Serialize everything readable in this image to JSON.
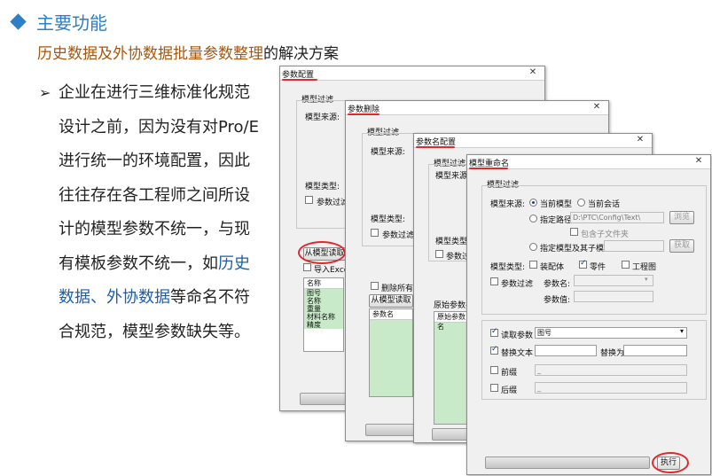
{
  "slide": {
    "title": "主要功能",
    "subtitle_highlight": "历史数据及外协数据批量参数整理",
    "subtitle_rest": "的解决方案",
    "bullet_part1": "企业在进行三维标准化规范设计之前，因为没有对Pro/E进行统一的环境配置，因此往往存在各工程师之间所设计的模型参数不统一，与现有模板参数不统一，如",
    "bullet_blue": "历史数据、外协数据",
    "bullet_part2": "等命名不符合规范，模型参数缺失等。"
  },
  "dialog1": {
    "title": "参数配置",
    "group": "模型过滤",
    "source_label": "模型来源:",
    "type_label": "模型类型:",
    "param_filter": "参数过滤",
    "read_button": "从模型读取",
    "import_excel": "导入Excel",
    "list_header": "名称",
    "list_rows": [
      "图号",
      "名称",
      "重量",
      "材料名称",
      "精度"
    ]
  },
  "dialog2": {
    "title": "参数删除",
    "group": "模型过滤",
    "source_label": "模型来源:",
    "type_label": "模型类型:",
    "param_filter": "参数过滤",
    "delete_all": "删除所有参",
    "read_button": "从模型读取",
    "list_header": "参数名"
  },
  "dialog3": {
    "title": "参数名配置",
    "group": "模型过滤",
    "source_label": "模型来源:",
    "type_label": "模型类型:",
    "param_filter": "参数过滤",
    "list_label": "原始参数名",
    "list_header": "原始参数名"
  },
  "dialog4": {
    "title": "模型重命名",
    "group": "模型过滤",
    "source_label": "模型来源:",
    "current_model": "当前模型",
    "current_session": "当前会话",
    "specify_path": "指定路径",
    "path_value": "D:\\PTC\\Config\\Text\\",
    "browse": "浏览",
    "include_sub": "包含子文件夹",
    "specify_model": "指定模型及其子模型",
    "fetch": "获取",
    "type_label": "模型类型:",
    "assembly": "装配体",
    "part": "零件",
    "drawing": "工程图",
    "param_filter": "参数过滤",
    "param_name": "参数名:",
    "param_value": "参数值:",
    "read_param": "读取参数",
    "read_param_value": "图号",
    "replace_text": "替换文本",
    "replace_with": "替换为",
    "prefix": "前缀",
    "prefix_value": "_",
    "suffix": "后缀",
    "suffix_value": "_",
    "execute": "执行"
  },
  "close_glyph": "✕"
}
